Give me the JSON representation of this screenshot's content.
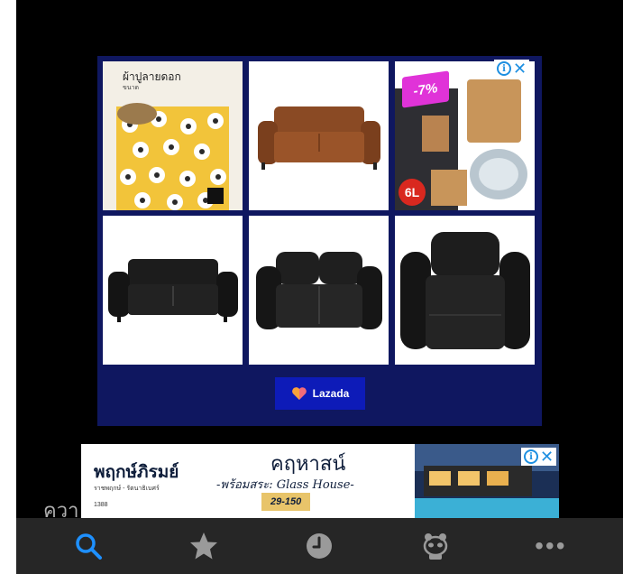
{
  "ad_grid": {
    "fabric_title": "ผ้าปูลายดอก",
    "fabric_size": "ขนาด",
    "discount_label": "-7%",
    "capacity_label": "6L",
    "lazada_label": "Lazada"
  },
  "banner_ad": {
    "brand": "พฤกษ์ภิรมย์",
    "brand_sub": "ราชพฤกษ์ - รัตนาธิเบศร์",
    "brand_phone": "1388",
    "headline": "คฤหาสน์",
    "subline": "-พร้อมสระ: Glass House-",
    "price": "29-150"
  },
  "partial_text": "ควา",
  "toolbar": {
    "items": [
      {
        "icon": "search-icon",
        "active": true
      },
      {
        "icon": "star-icon",
        "active": false
      },
      {
        "icon": "clock-icon",
        "active": false
      },
      {
        "icon": "panda-icon",
        "active": false
      },
      {
        "icon": "more-icon",
        "label": "•••",
        "active": false
      }
    ]
  },
  "colors": {
    "active_tab": "#1e90ff",
    "inactive_tab": "#9a9a9a",
    "ad_navy": "#0f1760",
    "lazada_blue": "#0d1bb8",
    "adchoice_blue": "#1d8fe1"
  }
}
